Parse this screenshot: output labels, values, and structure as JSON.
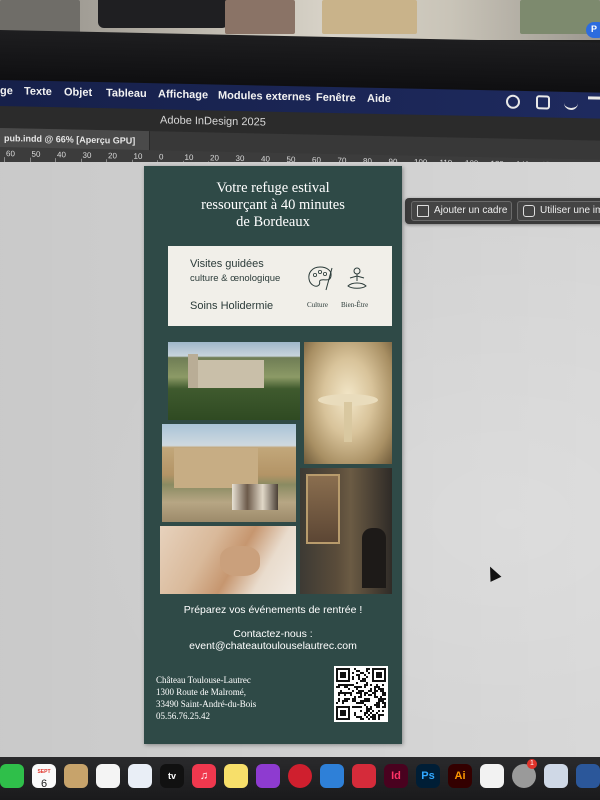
{
  "menubar": {
    "items": [
      "ge",
      "Texte",
      "Objet",
      "Tableau",
      "Affichage",
      "Modules externes",
      "Fenêtre",
      "Aide"
    ]
  },
  "app": {
    "title": "Adobe InDesign 2025",
    "user_initial": "P"
  },
  "document_tab": {
    "label": "pub.indd @ 66% [Aperçu GPU]"
  },
  "ruler": {
    "labels": [
      "60",
      "50",
      "40",
      "30",
      "20",
      "10",
      "0",
      "10",
      "20",
      "30",
      "40",
      "50",
      "60",
      "70",
      "80",
      "90",
      "100",
      "110",
      "120",
      "130",
      "140",
      "150",
      "160",
      "17"
    ]
  },
  "context_bar": {
    "add_frame": "Ajouter un cadre",
    "use_image": "Utiliser une im"
  },
  "ad": {
    "headline": [
      "Votre refuge estival",
      "ressourçant à 40 minutes",
      "de Bordeaux"
    ],
    "info": {
      "visites": "Visites guidées",
      "culture_oeno": "culture & œnologique",
      "soins": "Soins Holidermie",
      "icon_culture": "Culture",
      "icon_bien_etre": "Bien-Être"
    },
    "photos": [
      "chateau-vineyard",
      "fountain",
      "courtyard-event",
      "portrait-gallery",
      "massage-spa"
    ],
    "cta_events": "Préparez vos événements de rentrée !",
    "contact_label": "Contactez-nous :",
    "contact_email": "event@chateautoulouselautrec.com",
    "address": [
      "Château Toulouse-Lautrec",
      "1300 Route de Malromé,",
      "33490 Saint-André-du-Bois",
      "05.56.76.25.42"
    ],
    "colors": {
      "page_bg": "#2f4a47",
      "info_bg": "#f1efe9"
    }
  },
  "dock": {
    "calendar_month": "SEPT",
    "calendar_day": "6",
    "apps": [
      "Id",
      "Ps",
      "Ai"
    ],
    "badge": "1"
  }
}
